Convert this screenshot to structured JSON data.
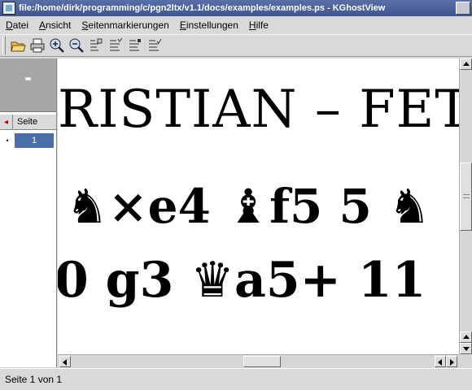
{
  "window": {
    "title": "file:/home/dirk/programming/c/pgn2ltx/v1.1/docs/examples/examples.ps - KGhostView"
  },
  "menu": [
    {
      "label_acc": "D",
      "label_rest": "atei"
    },
    {
      "label_acc": "A",
      "label_rest": "nsicht"
    },
    {
      "label_acc": "S",
      "label_rest": "eitenmarkierungen"
    },
    {
      "label_acc": "E",
      "label_rest": "instellungen"
    },
    {
      "label_acc": "H",
      "label_rest": "ilfe"
    }
  ],
  "toolbar": {
    "icons": [
      "open-icon",
      "print-icon",
      "zoom-in-icon",
      "zoom-out-icon",
      "mark-page-icon",
      "mark-even-icon",
      "mark-odd-icon",
      "mark-all-icon"
    ]
  },
  "page_list": {
    "header_label": "Seite",
    "pages": [
      {
        "marker": "•",
        "number": "1"
      }
    ]
  },
  "document": {
    "line1": "RISTIAN – FETT",
    "line2_parts": [
      "♞",
      "×e4 ",
      "♝",
      "f5 5 ",
      "♞"
    ],
    "line3_parts": [
      "0 g3 ",
      "♛",
      "a5+ 11"
    ]
  },
  "status": {
    "text": "Seite 1 von 1"
  }
}
